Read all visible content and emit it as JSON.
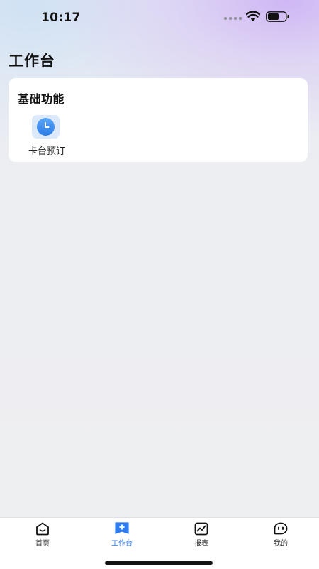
{
  "status_bar": {
    "time": "10:17",
    "wifi_icon": "wifi-icon",
    "battery_icon": "battery-icon"
  },
  "header": {
    "title": "工作台"
  },
  "card": {
    "title": "基础功能",
    "items": [
      {
        "label": "卡台预订",
        "icon": "clock-icon"
      }
    ]
  },
  "tab_bar": {
    "active_index": 1,
    "active_color": "#2f7bf0",
    "tabs": [
      {
        "label": "首页",
        "icon": "home-icon"
      },
      {
        "label": "工作台",
        "icon": "workbench-icon"
      },
      {
        "label": "报表",
        "icon": "chart-icon"
      },
      {
        "label": "我的",
        "icon": "profile-icon"
      }
    ]
  }
}
